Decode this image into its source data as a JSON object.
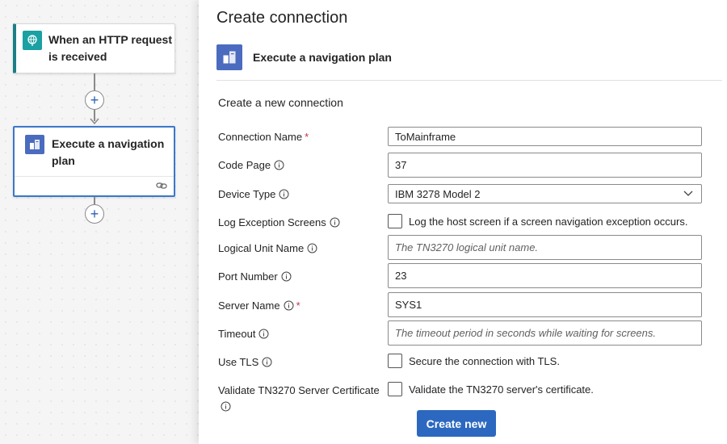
{
  "canvas": {
    "trigger": {
      "title": "When an HTTP request is received",
      "icon": "globe-icon"
    },
    "action": {
      "title": "Execute a navigation plan",
      "icon": "host-integration-icon",
      "footer_icon": "link-icon"
    },
    "add_step_label": "+"
  },
  "panel": {
    "title": "Create connection",
    "connector_name": "Execute a navigation plan",
    "section_heading": "Create a new connection",
    "fields": {
      "connection_name": {
        "label": "Connection Name",
        "required": "*",
        "value": "ToMainframe"
      },
      "code_page": {
        "label": "Code Page",
        "value": "37"
      },
      "device_type": {
        "label": "Device Type",
        "value": "IBM 3278 Model 2"
      },
      "log_exception_screens": {
        "label": "Log Exception Screens",
        "checkbox_label": "Log the host screen if a screen navigation exception occurs."
      },
      "logical_unit_name": {
        "label": "Logical Unit Name",
        "placeholder": "The TN3270 logical unit name."
      },
      "port_number": {
        "label": "Port Number",
        "value": "23"
      },
      "server_name": {
        "label": "Server Name",
        "required": "*",
        "value": "SYS1"
      },
      "timeout": {
        "label": "Timeout",
        "placeholder": "The timeout period in seconds while waiting for screens."
      },
      "use_tls": {
        "label": "Use TLS",
        "checkbox_label": "Secure the connection with TLS."
      },
      "validate_cert": {
        "label": "Validate TN3270 Server Certificate",
        "checkbox_label": "Validate the TN3270 server's certificate."
      }
    },
    "create_button": "Create new"
  },
  "colors": {
    "accent": "#2c68c0",
    "trigger_accent": "#1b7f86",
    "connector_icon": "#4b6bbf",
    "required": "#c4314b"
  }
}
